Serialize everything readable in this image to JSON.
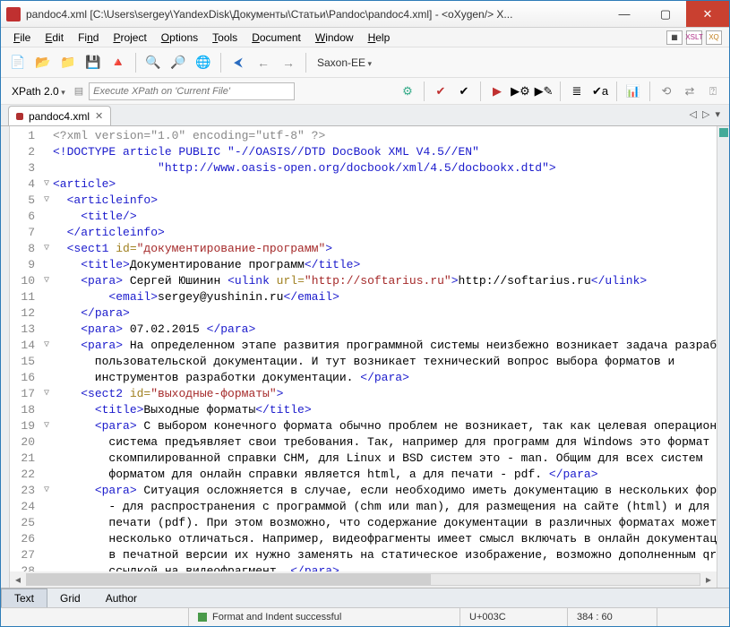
{
  "title": "pandoc4.xml [C:\\Users\\sergey\\YandexDisk\\Документы\\Статьи\\Pandoc\\pandoc4.xml] - <oXygen/> X...",
  "menu": [
    "File",
    "Edit",
    "Find",
    "Project",
    "Options",
    "Tools",
    "Document",
    "Window",
    "Help"
  ],
  "menuRight": [
    "",
    "XSLT",
    "XQ"
  ],
  "toolbar": {
    "transformer": "Saxon-EE"
  },
  "xpath": {
    "label": "XPath 2.0",
    "placeholder": "Execute XPath on 'Current File'"
  },
  "tab": {
    "name": "pandoc4.xml"
  },
  "modes": [
    "Text",
    "Grid",
    "Author"
  ],
  "status": {
    "msg": "Format and Indent successful",
    "unicode": "U+003C",
    "pos": "384 : 60"
  },
  "code": [
    {
      "n": 1,
      "f": "",
      "seg": [
        {
          "c": "pi",
          "t": "<?xml version=\"1.0\" encoding=\"utf-8\" ?>"
        }
      ]
    },
    {
      "n": 2,
      "f": "",
      "seg": [
        {
          "c": "com",
          "t": "<!DOCTYPE article PUBLIC \"-//OASIS//DTD DocBook XML V4.5//EN\""
        }
      ]
    },
    {
      "n": 3,
      "f": "",
      "seg": [
        {
          "c": "com",
          "t": "               \"http://www.oasis-open.org/docbook/xml/4.5/docbookx.dtd\">"
        }
      ]
    },
    {
      "n": 4,
      "f": "▽",
      "seg": [
        {
          "c": "tag",
          "t": "<article>"
        }
      ]
    },
    {
      "n": 5,
      "f": "▽",
      "seg": [
        {
          "c": "txt",
          "t": "  "
        },
        {
          "c": "tag",
          "t": "<articleinfo>"
        }
      ]
    },
    {
      "n": 6,
      "f": "",
      "seg": [
        {
          "c": "txt",
          "t": "    "
        },
        {
          "c": "tag",
          "t": "<title/>"
        }
      ]
    },
    {
      "n": 7,
      "f": "",
      "seg": [
        {
          "c": "txt",
          "t": "  "
        },
        {
          "c": "tag",
          "t": "</articleinfo>"
        }
      ]
    },
    {
      "n": 8,
      "f": "▽",
      "seg": [
        {
          "c": "txt",
          "t": "  "
        },
        {
          "c": "tag",
          "t": "<sect1 "
        },
        {
          "c": "attr",
          "t": "id="
        },
        {
          "c": "val",
          "t": "\"документирование-программ\""
        },
        {
          "c": "tag",
          "t": ">"
        }
      ]
    },
    {
      "n": 9,
      "f": "",
      "seg": [
        {
          "c": "txt",
          "t": "    "
        },
        {
          "c": "tag",
          "t": "<title>"
        },
        {
          "c": "txt",
          "t": "Документирование программ"
        },
        {
          "c": "tag",
          "t": "</title>"
        }
      ]
    },
    {
      "n": 10,
      "f": "▽",
      "seg": [
        {
          "c": "txt",
          "t": "    "
        },
        {
          "c": "tag",
          "t": "<para>"
        },
        {
          "c": "txt",
          "t": " Сергей Юшинин "
        },
        {
          "c": "tag",
          "t": "<ulink "
        },
        {
          "c": "attr",
          "t": "url="
        },
        {
          "c": "val",
          "t": "\"http://softarius.ru\""
        },
        {
          "c": "tag",
          "t": ">"
        },
        {
          "c": "txt",
          "t": "http://softarius.ru"
        },
        {
          "c": "tag",
          "t": "</ulink>"
        }
      ]
    },
    {
      "n": 11,
      "f": "",
      "seg": [
        {
          "c": "txt",
          "t": "        "
        },
        {
          "c": "tag",
          "t": "<email>"
        },
        {
          "c": "txt",
          "t": "sergey@yushinin.ru"
        },
        {
          "c": "tag",
          "t": "</email>"
        }
      ]
    },
    {
      "n": 12,
      "f": "",
      "seg": [
        {
          "c": "txt",
          "t": "    "
        },
        {
          "c": "tag",
          "t": "</para>"
        }
      ]
    },
    {
      "n": 13,
      "f": "",
      "seg": [
        {
          "c": "txt",
          "t": "    "
        },
        {
          "c": "tag",
          "t": "<para>"
        },
        {
          "c": "txt",
          "t": " 07.02.2015 "
        },
        {
          "c": "tag",
          "t": "</para>"
        }
      ]
    },
    {
      "n": 14,
      "f": "▽",
      "seg": [
        {
          "c": "txt",
          "t": "    "
        },
        {
          "c": "tag",
          "t": "<para>"
        },
        {
          "c": "txt",
          "t": " На определенном этапе развития программной системы неизбежно возникает задача разработки"
        }
      ]
    },
    {
      "n": 15,
      "f": "",
      "seg": [
        {
          "c": "txt",
          "t": "      пользовательской документации. И тут возникает технический вопрос выбора форматов и"
        }
      ]
    },
    {
      "n": 16,
      "f": "",
      "seg": [
        {
          "c": "txt",
          "t": "      инструментов разработки документации. "
        },
        {
          "c": "tag",
          "t": "</para>"
        }
      ]
    },
    {
      "n": 17,
      "f": "▽",
      "seg": [
        {
          "c": "txt",
          "t": "    "
        },
        {
          "c": "tag",
          "t": "<sect2 "
        },
        {
          "c": "attr",
          "t": "id="
        },
        {
          "c": "val",
          "t": "\"выходные-форматы\""
        },
        {
          "c": "tag",
          "t": ">"
        }
      ]
    },
    {
      "n": 18,
      "f": "",
      "seg": [
        {
          "c": "txt",
          "t": "      "
        },
        {
          "c": "tag",
          "t": "<title>"
        },
        {
          "c": "txt",
          "t": "Выходные форматы"
        },
        {
          "c": "tag",
          "t": "</title>"
        }
      ]
    },
    {
      "n": 19,
      "f": "▽",
      "seg": [
        {
          "c": "txt",
          "t": "      "
        },
        {
          "c": "tag",
          "t": "<para>"
        },
        {
          "c": "txt",
          "t": " С выбором конечного формата обычно проблем не возникает, так как целевая операционная"
        }
      ]
    },
    {
      "n": 20,
      "f": "",
      "seg": [
        {
          "c": "txt",
          "t": "        система предъявляет свои требования. Так, например для программ для Windows это формат"
        }
      ]
    },
    {
      "n": 21,
      "f": "",
      "seg": [
        {
          "c": "txt",
          "t": "        скомпилированной справки CHM, для Linux и BSD систем это - man. Общим для всех систем"
        }
      ]
    },
    {
      "n": 22,
      "f": "",
      "seg": [
        {
          "c": "txt",
          "t": "        форматом для онлайн справки является html, а для печати - pdf. "
        },
        {
          "c": "tag",
          "t": "</para>"
        }
      ]
    },
    {
      "n": 23,
      "f": "▽",
      "seg": [
        {
          "c": "txt",
          "t": "      "
        },
        {
          "c": "tag",
          "t": "<para>"
        },
        {
          "c": "txt",
          "t": " Ситуация осложняется в случае, если необходимо иметь документацию в нескольких форматах"
        }
      ]
    },
    {
      "n": 24,
      "f": "",
      "seg": [
        {
          "c": "txt",
          "t": "        - для распространения с программой (chm или man), для размещения на сайте (html) и для"
        }
      ]
    },
    {
      "n": 25,
      "f": "",
      "seg": [
        {
          "c": "txt",
          "t": "        печати (pdf). При этом возможно, что содержание документации в различных форматах может"
        }
      ]
    },
    {
      "n": 26,
      "f": "",
      "seg": [
        {
          "c": "txt",
          "t": "        несколько отличаться. Например, видеофрагменты имеет смысл включать в онлайн документацию, а"
        }
      ]
    },
    {
      "n": 27,
      "f": "",
      "seg": [
        {
          "c": "txt",
          "t": "        в печатной версии их нужно заменять на статическое изображение, возможно дополненным qrcode"
        }
      ]
    },
    {
      "n": 28,
      "f": "",
      "seg": [
        {
          "c": "txt",
          "t": "        ссылкой на видеофрагмент. "
        },
        {
          "c": "tag",
          "t": "</para>"
        }
      ]
    }
  ]
}
